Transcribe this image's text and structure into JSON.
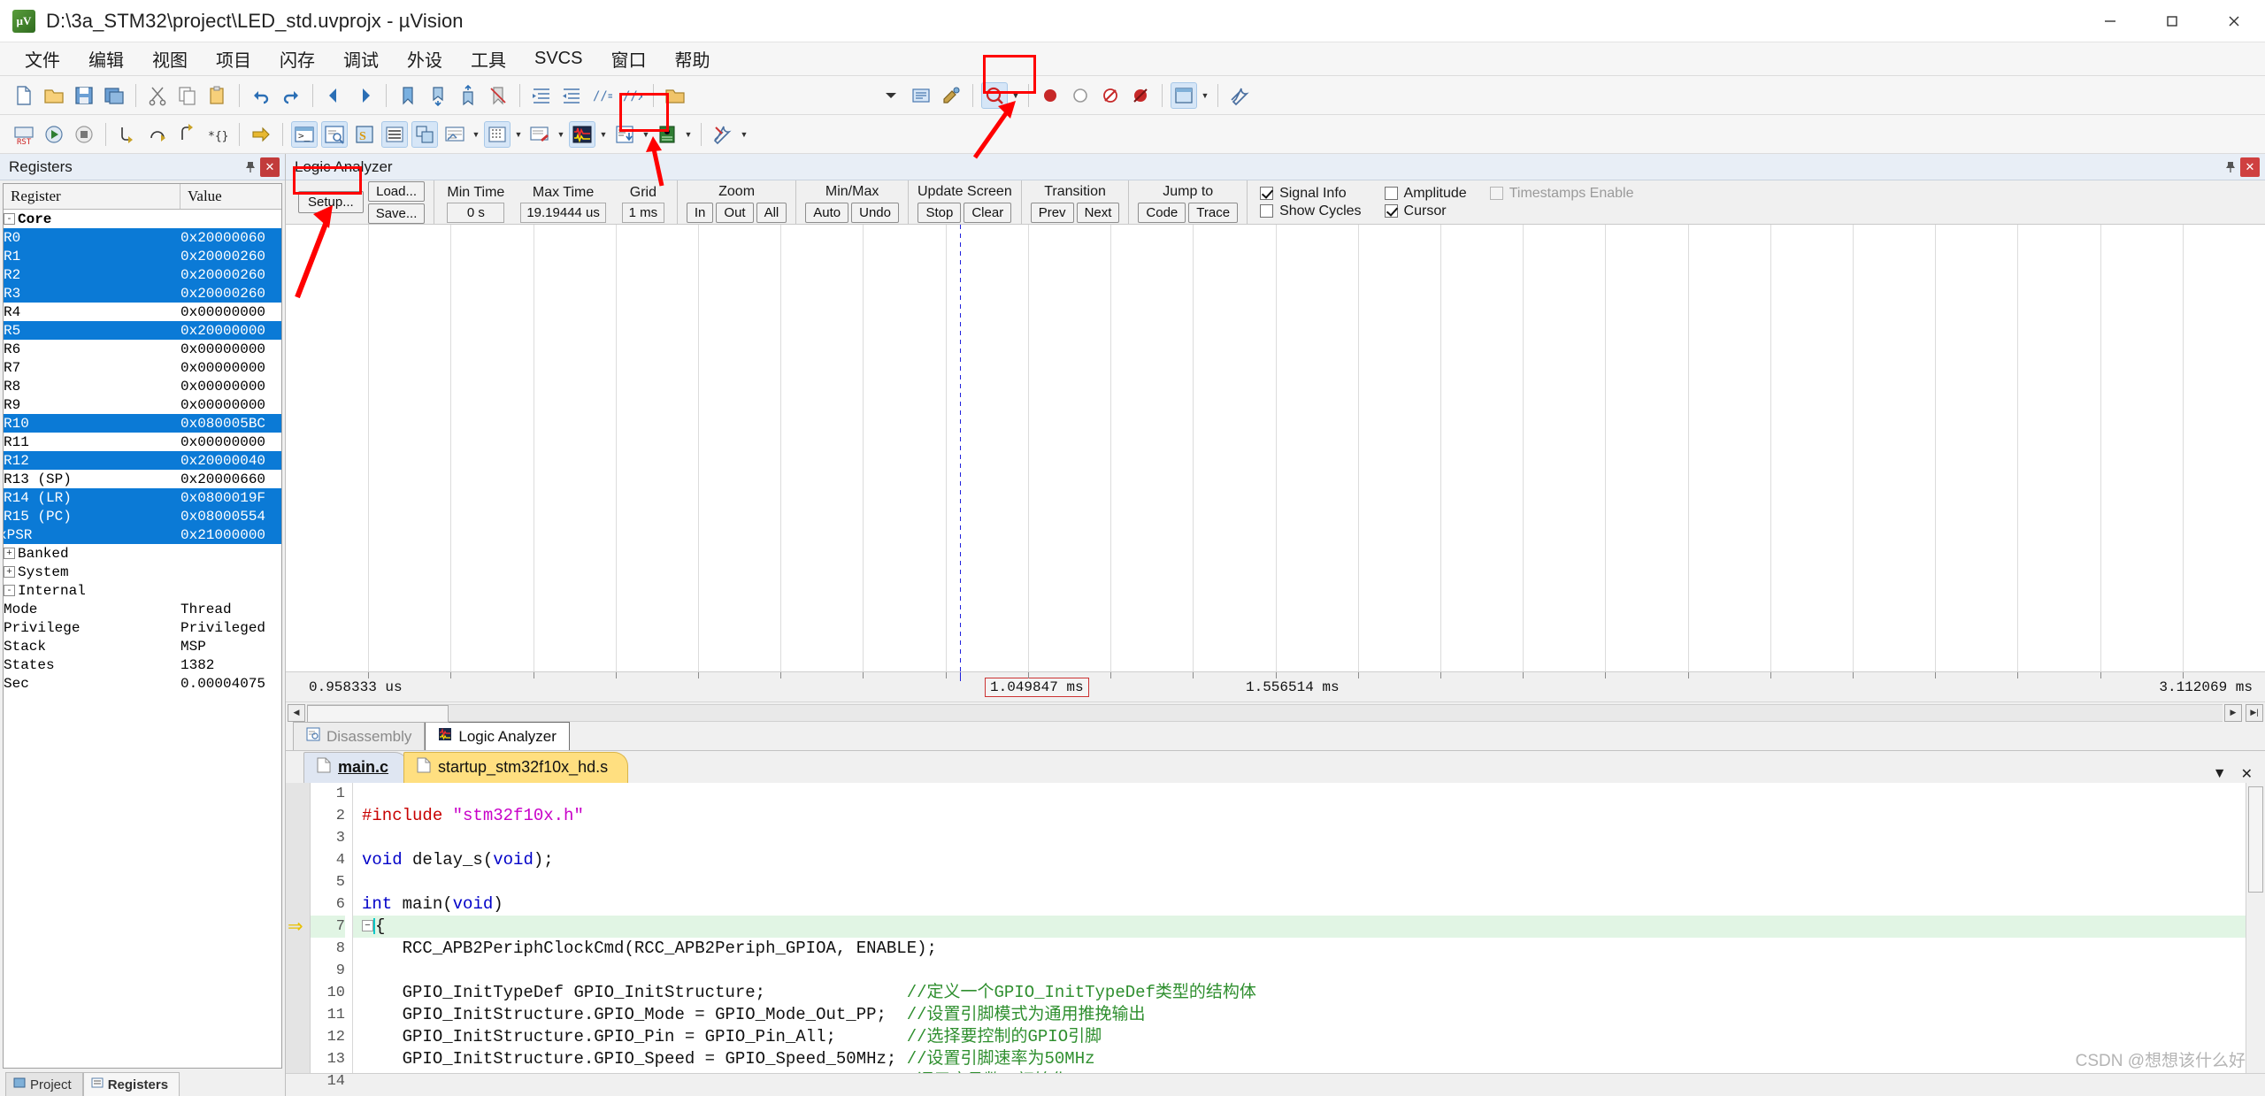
{
  "window": {
    "title": "D:\\3a_STM32\\project\\LED_std.uvprojx - µVision",
    "icon": "uvision-logo-icon",
    "minimize": "minimize-button",
    "maximize": "maximize-button",
    "close": "close-button"
  },
  "menu": {
    "items": [
      {
        "label": "文件"
      },
      {
        "label": "编辑"
      },
      {
        "label": "视图"
      },
      {
        "label": "项目"
      },
      {
        "label": "闪存"
      },
      {
        "label": "调试"
      },
      {
        "label": "外设"
      },
      {
        "label": "工具"
      },
      {
        "label": "SVCS"
      },
      {
        "label": "窗口"
      },
      {
        "label": "帮助"
      }
    ]
  },
  "registers_panel": {
    "title": "Registers",
    "pin_icon": "pin-icon",
    "close_icon": "close-icon",
    "columns": [
      "Register",
      "Value"
    ],
    "rows": [
      {
        "name": "Core",
        "value": "",
        "level": 0,
        "expander": "-",
        "selected": false,
        "bold": true
      },
      {
        "name": "R0",
        "value": "0x20000060",
        "level": 2,
        "selected": true
      },
      {
        "name": "R1",
        "value": "0x20000260",
        "level": 2,
        "selected": true
      },
      {
        "name": "R2",
        "value": "0x20000260",
        "level": 2,
        "selected": true
      },
      {
        "name": "R3",
        "value": "0x20000260",
        "level": 2,
        "selected": true
      },
      {
        "name": "R4",
        "value": "0x00000000",
        "level": 2,
        "selected": false
      },
      {
        "name": "R5",
        "value": "0x20000000",
        "level": 2,
        "selected": true
      },
      {
        "name": "R6",
        "value": "0x00000000",
        "level": 2,
        "selected": false
      },
      {
        "name": "R7",
        "value": "0x00000000",
        "level": 2,
        "selected": false
      },
      {
        "name": "R8",
        "value": "0x00000000",
        "level": 2,
        "selected": false
      },
      {
        "name": "R9",
        "value": "0x00000000",
        "level": 2,
        "selected": false
      },
      {
        "name": "R10",
        "value": "0x080005BC",
        "level": 2,
        "selected": true
      },
      {
        "name": "R11",
        "value": "0x00000000",
        "level": 2,
        "selected": false
      },
      {
        "name": "R12",
        "value": "0x20000040",
        "level": 2,
        "selected": true
      },
      {
        "name": "R13 (SP)",
        "value": "0x20000660",
        "level": 2,
        "selected": false
      },
      {
        "name": "R14 (LR)",
        "value": "0x0800019F",
        "level": 2,
        "selected": true
      },
      {
        "name": "R15 (PC)",
        "value": "0x08000554",
        "level": 2,
        "selected": true
      },
      {
        "name": "xPSR",
        "value": "0x21000000",
        "level": 2,
        "expander": "+",
        "selected": true
      },
      {
        "name": "Banked",
        "value": "",
        "level": 0,
        "expander": "+",
        "selected": false
      },
      {
        "name": "System",
        "value": "",
        "level": 0,
        "expander": "+",
        "selected": false
      },
      {
        "name": "Internal",
        "value": "",
        "level": 0,
        "expander": "-",
        "selected": false
      },
      {
        "name": "Mode",
        "value": "Thread",
        "level": 2,
        "selected": false
      },
      {
        "name": "Privilege",
        "value": "Privileged",
        "level": 2,
        "selected": false
      },
      {
        "name": "Stack",
        "value": "MSP",
        "level": 2,
        "selected": false
      },
      {
        "name": "States",
        "value": "1382",
        "level": 2,
        "selected": false
      },
      {
        "name": "Sec",
        "value": "0.00004075",
        "level": 2,
        "selected": false
      }
    ],
    "bottom_tabs": [
      {
        "label": "Project",
        "icon": "project-icon",
        "active": false
      },
      {
        "label": "Registers",
        "icon": "registers-icon",
        "active": true
      }
    ]
  },
  "logic_analyzer": {
    "title": "Logic Analyzer",
    "pin_icon": "pin-icon",
    "close_icon": "close-icon",
    "toolbar": {
      "setup_button": "Setup...",
      "load_button": "Load...",
      "save_button": "Save...",
      "min_time_label": "Min Time",
      "min_time_value": "0 s",
      "max_time_label": "Max Time",
      "max_time_value": "19.19444 us",
      "grid_label": "Grid",
      "grid_value": "1 ms",
      "zoom_label": "Zoom",
      "zoom_in": "In",
      "zoom_out": "Out",
      "zoom_all": "All",
      "minmax_label": "Min/Max",
      "minmax_auto": "Auto",
      "minmax_undo": "Undo",
      "update_label": "Update Screen",
      "update_stop": "Stop",
      "update_clear": "Clear",
      "transition_label": "Transition",
      "transition_prev": "Prev",
      "transition_next": "Next",
      "jumpto_label": "Jump to",
      "jumpto_code": "Code",
      "jumpto_trace": "Trace",
      "checks": [
        {
          "label": "Signal Info",
          "checked": true,
          "disabled": false
        },
        {
          "label": "Amplitude",
          "checked": false,
          "disabled": false
        },
        {
          "label": "Timestamps Enable",
          "checked": false,
          "disabled": true
        },
        {
          "label": "Show Cycles",
          "checked": false,
          "disabled": false
        },
        {
          "label": "Cursor",
          "checked": true,
          "disabled": false
        }
      ]
    },
    "axis": {
      "left_label": "0.958333 us",
      "cursor_label": "1.049847 ms",
      "right_label_mid": "1.556514 ms",
      "right_label": "3.112069 ms"
    },
    "tabs": [
      {
        "label": "Disassembly",
        "icon": "disassembly-icon",
        "active": false
      },
      {
        "label": "Logic Analyzer",
        "icon": "logic-analyzer-icon",
        "active": true
      }
    ]
  },
  "editor": {
    "tabs": [
      {
        "label": "main.c",
        "icon": "c-file-icon",
        "active": true,
        "color": "blue"
      },
      {
        "label": "startup_stm32f10x_hd.s",
        "icon": "asm-file-icon",
        "active": false,
        "color": "yellow"
      }
    ],
    "dropdown_icon": "chevron-down-icon",
    "close_icon": "close-icon",
    "lines": [
      {
        "n": "1",
        "html": ""
      },
      {
        "n": "2",
        "html": "<span class=\"pp\">#include</span> <span class=\"str\">\"stm32f10x.h\"</span>"
      },
      {
        "n": "3",
        "html": ""
      },
      {
        "n": "4",
        "html": "<span class=\"kw\">void</span> delay_s(<span class=\"kw\">void</span>);"
      },
      {
        "n": "5",
        "html": ""
      },
      {
        "n": "6",
        "html": "<span class=\"kw\">int</span> main(<span class=\"kw\">void</span>)"
      },
      {
        "n": "7",
        "html": "<span class=\"fold\">−</span><span class=\"caret\"></span>{",
        "current": true,
        "pc": true,
        "fold": true
      },
      {
        "n": "8",
        "html": "    RCC_APB2PeriphClockCmd(RCC_APB2Periph_GPIOA, ENABLE);"
      },
      {
        "n": "9",
        "html": ""
      },
      {
        "n": "10",
        "html": "    GPIO_InitTypeDef GPIO_InitStructure;              <span class=\"cm\">//定义一个GPIO_InitTypeDef类型的结构体</span>"
      },
      {
        "n": "11",
        "html": "    GPIO_InitStructure.GPIO_Mode = GPIO_Mode_Out_PP;  <span class=\"cm\">//设置引脚模式为通用推挽输出</span>"
      },
      {
        "n": "12",
        "html": "    GPIO_InitStructure.GPIO_Pin = GPIO_Pin_All;       <span class=\"cm\">//选择要控制的GPIO引脚</span>"
      },
      {
        "n": "13",
        "html": "    GPIO_InitStructure.GPIO_Speed = GPIO_Speed_50MHz; <span class=\"cm\">//设置引脚速率为50MHz</span>"
      },
      {
        "n": "14",
        "html": "    GPIO_Init(GPIOA, &amp;GPIO_InitStructure);           <span class=\"cm\">//调用库函数，初始化GPIO</span>"
      }
    ]
  },
  "watermark": "CSDN @想想该什么好",
  "colors": {
    "selection_blue": "#0b7ad6",
    "highlight_red": "#ff0000",
    "current_line_green": "#e1f5e4",
    "tab_yellow": "#ffdf80",
    "cursor_blue": "#2222dd"
  }
}
